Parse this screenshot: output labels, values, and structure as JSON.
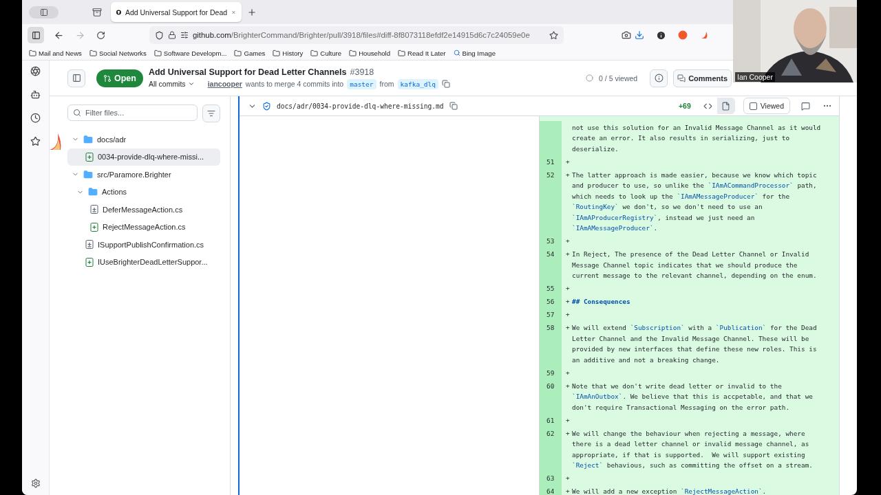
{
  "browser": {
    "tabs": [
      {
        "title": "Add Universal Support for Dead",
        "selected": true
      }
    ],
    "url": {
      "host": "github.com",
      "path": "/BrighterCommand/Brighter/pull/3918/files#diff-8f8073118efdf2e14915d6c7c24059e0e"
    },
    "bookmarks": [
      {
        "kind": "folder",
        "label": "Mail and News"
      },
      {
        "kind": "folder",
        "label": "Social Networks"
      },
      {
        "kind": "folder",
        "label": "Software Developm..."
      },
      {
        "kind": "folder",
        "label": "Games"
      },
      {
        "kind": "folder",
        "label": "History"
      },
      {
        "kind": "folder",
        "label": "Culture"
      },
      {
        "kind": "folder",
        "label": "Household"
      },
      {
        "kind": "folder",
        "label": "Read It Later"
      },
      {
        "kind": "search",
        "label": "Bing Image"
      }
    ]
  },
  "pull_request": {
    "state": "Open",
    "title": "Add Universal Support for Dead Letter Channels",
    "number": "#3918",
    "commits_menu": "All commits",
    "author": "iancooper",
    "merge_text": "wants to merge 4 commits into",
    "base": "master",
    "from_text": "from",
    "head": "kafka_dlq",
    "viewed": "0 / 5 viewed",
    "comments_button": "Comments"
  },
  "file_tree": {
    "filter": {
      "placeholder": "Filter files..."
    },
    "items": [
      {
        "kind": "folder",
        "label": "docs/adr",
        "expanded": true,
        "selected": false,
        "children": [
          {
            "kind": "added",
            "label": "0034-provide-dlq-where-missi...",
            "selected": true
          }
        ]
      },
      {
        "kind": "folder",
        "label": "src/Paramore.Brighter",
        "expanded": true,
        "selected": false,
        "children": [
          {
            "kind": "folder",
            "label": "Actions",
            "expanded": true,
            "selected": false,
            "children": [
              {
                "kind": "modified",
                "label": "DeferMessageAction.cs",
                "selected": false
              },
              {
                "kind": "added",
                "label": "RejectMessageAction.cs",
                "selected": false
              }
            ]
          },
          {
            "kind": "modified",
            "label": "ISupportPublishConfirmation.cs",
            "selected": false
          },
          {
            "kind": "added",
            "label": "IUseBrighterDeadLetterSuppor...",
            "selected": false
          }
        ]
      }
    ]
  },
  "diff": {
    "file": {
      "path": "docs/adr/0034-provide-dlq-where-missing.md",
      "expanded": true,
      "additions": "+69",
      "view_toggle": [
        {
          "kind": "source",
          "selected": false
        },
        {
          "kind": "rich",
          "selected": true
        }
      ],
      "viewed_label": "Viewed",
      "viewed": false
    },
    "rows": [
      {
        "kind": "text",
        "lines": [
          "not use this solution for an Invalid Message Channel as it would",
          "create an error. It also results in serializing, just to",
          "deserialize."
        ]
      },
      {
        "number": "51",
        "sign": "+"
      },
      {
        "kind": "text",
        "number": "52",
        "sign": "+",
        "lines": [
          "The latter approach is made easier, because we know which topic",
          "and producer to use, so unlike the `IAmACommandProcessor` path,",
          "which needs to look up the `IAmAMessageProducer` for the",
          "`RoutingKey` we don't, so we don't need to use an",
          "`IAmAProducerRegistry`, instead we just need an",
          "`IAmAMessageProducer`."
        ]
      },
      {
        "number": "53",
        "sign": "+"
      },
      {
        "kind": "text",
        "number": "54",
        "sign": "+",
        "lines": [
          "In Reject, The presence of the Dead Letter Channel or Invalid",
          "Message Channel topic indicates that we should produce the",
          "current message to the relevant channel, depending on the enum."
        ]
      },
      {
        "number": "55",
        "sign": "+"
      },
      {
        "kind": "heading",
        "number": "56",
        "sign": "+",
        "lines": [
          "## Consequences"
        ]
      },
      {
        "number": "57",
        "sign": "+"
      },
      {
        "kind": "text",
        "number": "58",
        "sign": "+",
        "lines": [
          "We will extend `Subscription` with a `Publication` for the Dead",
          "Letter Channel and the Invalid Message Channel. These will be",
          "provided by new interfaces that define these new roles. This is",
          "an additive and not a breaking change."
        ]
      },
      {
        "number": "59",
        "sign": "+"
      },
      {
        "kind": "text",
        "number": "60",
        "sign": "+",
        "lines": [
          "Note that we don't write dead letter or invalid to the",
          "`IAmAnOutbox`. We believe that this is accpetable, and that we",
          "don't require Transactional Messaging on the error path."
        ]
      },
      {
        "number": "61",
        "sign": "+"
      },
      {
        "kind": "text",
        "number": "62",
        "sign": "+",
        "lines": [
          "We will change the behaviour when rejecting a message, where",
          "there is a dead letter channel or invalid message channel, as",
          "appropriate, if that is supported.  We will support existing",
          "`Reject` behavious, such as committing the offset on a stream."
        ]
      },
      {
        "number": "63",
        "sign": "+"
      },
      {
        "kind": "text",
        "number": "64",
        "sign": "+",
        "lines": [
          "We will add a new exception `RejectMessageAction`."
        ]
      }
    ]
  },
  "video": {
    "kind": "picture",
    "name": "Ian Cooper"
  }
}
